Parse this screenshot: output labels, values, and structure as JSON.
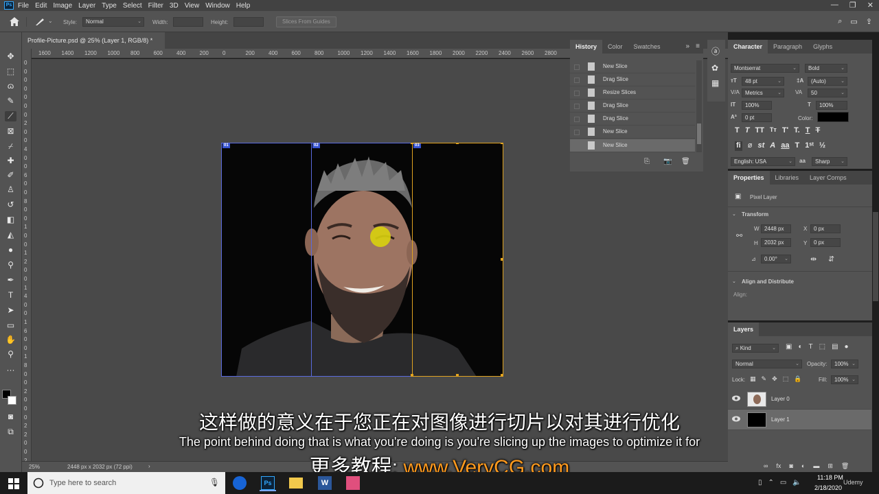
{
  "menubar": {
    "logo": "Ps",
    "items": [
      "File",
      "Edit",
      "Image",
      "Layer",
      "Type",
      "Select",
      "Filter",
      "3D",
      "View",
      "Window",
      "Help"
    ]
  },
  "options": {
    "style_label": "Style:",
    "style_value": "Normal",
    "width_label": "Width:",
    "height_label": "Height:",
    "slices_button": "Slices From Guides"
  },
  "document": {
    "tab_title": "Profile-Picture.psd @ 25% (Layer 1, RGB/8) *",
    "slice_labels": [
      "01",
      "02",
      "03"
    ]
  },
  "rulers": {
    "h_ticks": [
      "1600",
      "1400",
      "1200",
      "1000",
      "800",
      "600",
      "400",
      "200",
      "0",
      "200",
      "400",
      "600",
      "800",
      "1000",
      "1200",
      "1400",
      "1600",
      "1800",
      "2000",
      "2200",
      "2400",
      "2600",
      "2800"
    ],
    "v_ticks": [
      "0",
      "0",
      "0",
      "0",
      "0",
      "0",
      "0",
      "2",
      "0",
      "0",
      "4",
      "0",
      "0",
      "6",
      "0",
      "0",
      "8",
      "0",
      "0",
      "1",
      "0",
      "0",
      "1",
      "2",
      "0",
      "0",
      "1",
      "4",
      "0",
      "0",
      "1",
      "6",
      "0",
      "0",
      "1",
      "8",
      "0",
      "0",
      "2",
      "0",
      "0",
      "0",
      "2",
      "2",
      "0",
      "0",
      "2"
    ]
  },
  "status": {
    "zoom": "25%",
    "info": "2448 px x 2032 px (72 ppi)"
  },
  "history": {
    "tabs": [
      "History",
      "Color",
      "Swatches"
    ],
    "items": [
      "New Slice",
      "Drag Slice",
      "Resize Slices",
      "Drag Slice",
      "Drag Slice",
      "New Slice",
      "New Slice"
    ]
  },
  "character": {
    "tabs": [
      "Character",
      "Paragraph",
      "Glyphs"
    ],
    "font_family": "Montserrat",
    "font_style": "Bold",
    "font_size": "48 pt",
    "leading": "(Auto)",
    "kerning": "Metrics",
    "tracking": "50",
    "vertical_scale": "100%",
    "horizontal_scale": "100%",
    "baseline_shift": "0 pt",
    "color_label": "Color:",
    "language": "English: USA",
    "aa_label": "aa",
    "antialias": "Sharp"
  },
  "properties": {
    "tabs": [
      "Properties",
      "Libraries",
      "Layer Comps"
    ],
    "type_label": "Pixel Layer",
    "transform_label": "Transform",
    "w_label": "W",
    "w": "2448 px",
    "h_label": "H",
    "h": "2032 px",
    "x_label": "X",
    "x": "0 px",
    "y_label": "Y",
    "y": "0 px",
    "angle": "0.00°",
    "align_label": "Align and Distribute",
    "align_sub": "Align:"
  },
  "layers": {
    "tab": "Layers",
    "filter": "Kind",
    "blend_mode": "Normal",
    "opacity_label": "Opacity:",
    "opacity": "100%",
    "lock_label": "Lock:",
    "fill_label": "Fill:",
    "fill": "100%",
    "items": [
      {
        "name": "Layer 0"
      },
      {
        "name": "Layer 1"
      }
    ]
  },
  "subtitles": {
    "chinese": "这样做的意义在于您正在对图像进行切片以对其进行优化",
    "english": "The point behind doing that is what you're doing is you're slicing up the images to optimize it for",
    "promo_prefix": "更多教程: ",
    "promo_url": "www.VeryCG.com"
  },
  "taskbar": {
    "search_placeholder": "Type here to search",
    "time": "11:18 PM",
    "date": "2/18/2020",
    "watermark": "Udemy"
  },
  "colors": {
    "accent": "#31a8ff",
    "slice_blue": "#3653d1",
    "slice_orange": "#e2a420",
    "promo_orange": "#ff9a1e"
  }
}
